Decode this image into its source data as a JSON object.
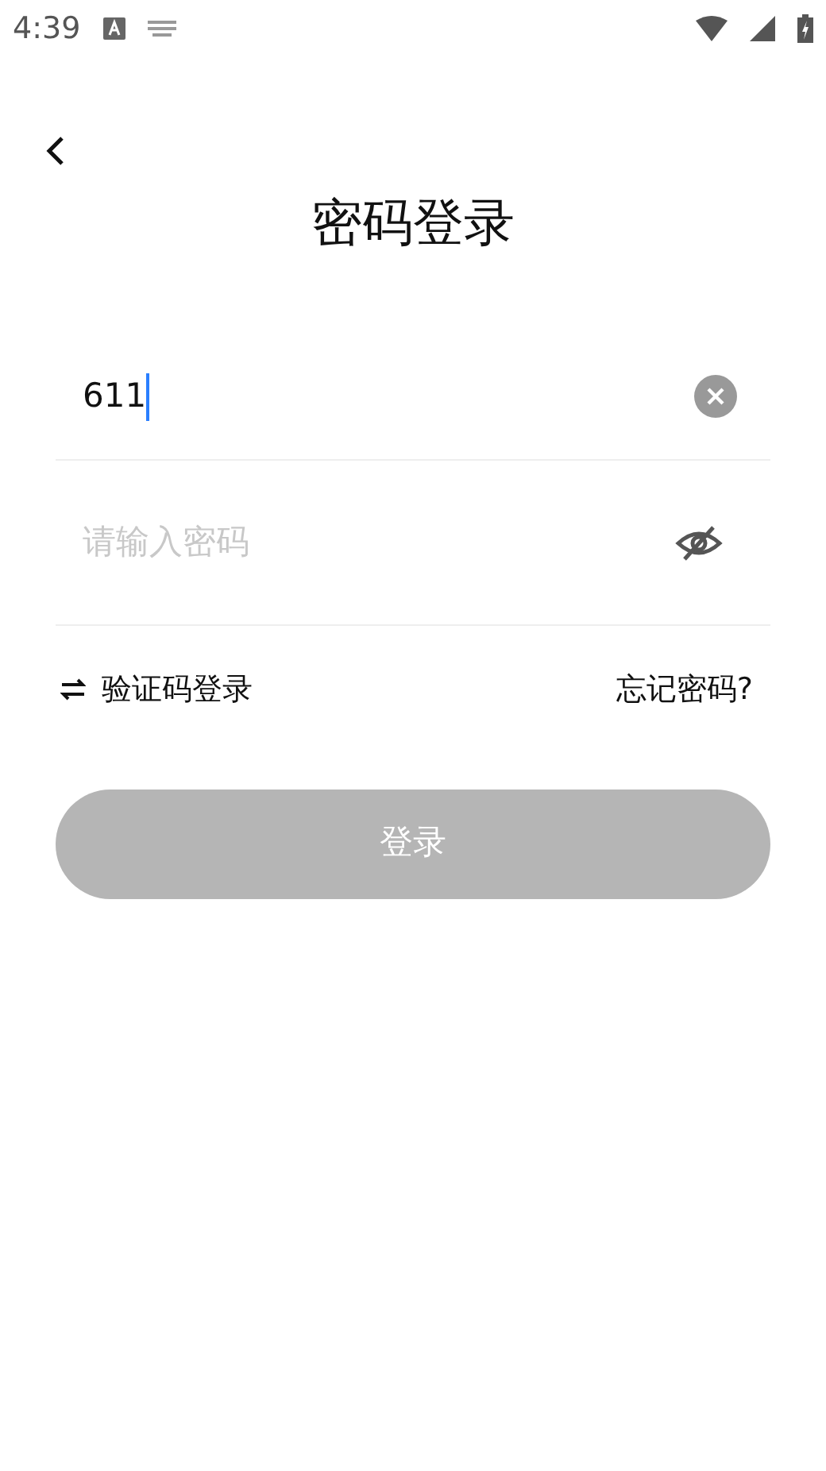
{
  "status_bar": {
    "time": "4:39"
  },
  "title": "密码登录",
  "phone_field": {
    "value": "611"
  },
  "password_field": {
    "placeholder": "请输入密码",
    "visible": false
  },
  "switch_link": {
    "label": "验证码登录"
  },
  "forgot_link": {
    "label": "忘记密码?"
  },
  "login_button": {
    "label": "登录",
    "disabled": true
  }
}
